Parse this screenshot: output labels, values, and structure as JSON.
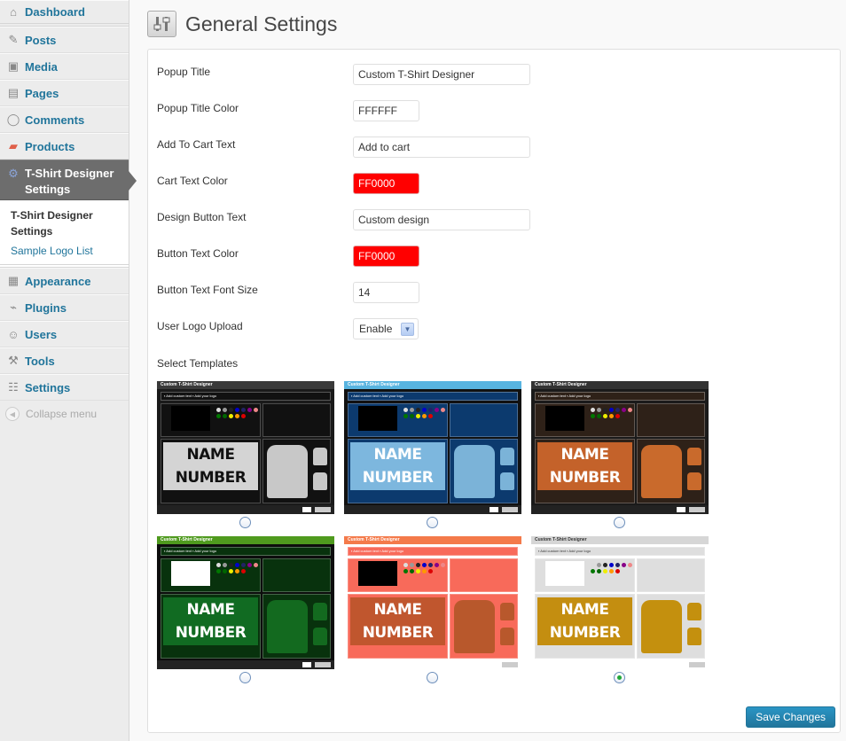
{
  "sidebar": {
    "items": [
      {
        "label": "Dashboard",
        "icon": "home-icon"
      },
      {
        "label": "Posts",
        "icon": "pushpin-icon"
      },
      {
        "label": "Media",
        "icon": "media-icon"
      },
      {
        "label": "Pages",
        "icon": "pages-icon"
      },
      {
        "label": "Comments",
        "icon": "comment-icon"
      },
      {
        "label": "Products",
        "icon": "products-icon"
      },
      {
        "label": "T-Shirt Designer Settings",
        "icon": "gear-icon"
      },
      {
        "label": "Appearance",
        "icon": "appearance-icon"
      },
      {
        "label": "Plugins",
        "icon": "plug-icon"
      },
      {
        "label": "Users",
        "icon": "users-icon"
      },
      {
        "label": "Tools",
        "icon": "tools-icon"
      },
      {
        "label": "Settings",
        "icon": "settings-icon"
      }
    ],
    "active_line1": "T-Shirt Designer",
    "active_line2": "Settings",
    "submenu": [
      {
        "label": "T-Shirt Designer Settings",
        "current": true
      },
      {
        "label": "Sample Logo List",
        "current": false
      }
    ],
    "collapse_label": "Collapse menu"
  },
  "header": {
    "title": "General Settings"
  },
  "form": {
    "popup_title": {
      "label": "Popup Title",
      "value": "Custom T-Shirt Designer"
    },
    "popup_title_color": {
      "label": "Popup Title Color",
      "value": "FFFFFF"
    },
    "add_to_cart_text": {
      "label": "Add To Cart Text",
      "value": "Add to cart"
    },
    "cart_text_color": {
      "label": "Cart Text Color",
      "value": "FF0000"
    },
    "design_button_text": {
      "label": "Design Button Text",
      "value": "Custom design"
    },
    "button_text_color": {
      "label": "Button Text Color",
      "value": "FF0000"
    },
    "button_text_font_size": {
      "label": "Button Text Font Size",
      "value": "14"
    },
    "user_logo_upload": {
      "label": "User Logo Upload",
      "value": "Enable"
    },
    "select_templates_label": "Select Templates"
  },
  "templates": [
    {
      "name": "Black",
      "title": "Custom T-Shirt Designer",
      "bar": "#3a3a3a",
      "bg": "#1a1a1a",
      "panel": "#111",
      "preview": "#d4d4d4",
      "preview_text": "#111",
      "shirt": "#c8c8c8",
      "selected": false
    },
    {
      "name": "Blue",
      "title": "Custom T-Shirt Designer",
      "bar": "#58b4e0",
      "bg": "#111",
      "panel": "#0c3a6e",
      "preview": "#7db7de",
      "preview_text": "#fff",
      "shirt": "#7bb3d8",
      "selected": false
    },
    {
      "name": "Brown",
      "title": "Custom T-Shirt Designer",
      "bar": "#333",
      "bg": "#1a1a1a",
      "panel": "#2e2118",
      "preview": "#c4622a",
      "preview_text": "#fff",
      "shirt": "#c96a2c",
      "selected": false
    },
    {
      "name": "Green",
      "title": "Custom T-Shirt Designer",
      "bar": "#4f9a1e",
      "bg": "#0d0d0d",
      "panel": "#08320d",
      "preview": "#116b22",
      "preview_text": "#fff",
      "shirt": "#136a1f",
      "selected": false
    },
    {
      "name": "Salmon",
      "title": "Custom T-Shirt Designer",
      "bar": "#f47a4a",
      "bg": "#fff",
      "panel": "#f86a5a",
      "preview": "#c0562e",
      "preview_text": "#fff",
      "shirt": "#b8582c",
      "selected": false
    },
    {
      "name": "Gold",
      "title": "Custom T-Shirt Designer",
      "bar": "#d6d6d6",
      "bg": "#fff",
      "panel": "#dedede",
      "preview": "#c48e10",
      "preview_text": "#fff",
      "shirt": "#c4900e",
      "selected": true
    }
  ],
  "template_texts": {
    "add_custom_text": "Add custom text",
    "add_your_logo": "Add your logo",
    "preview_line1": "NAME",
    "preview_line2": "NUMBER"
  },
  "actions": {
    "save_label": "Save Changes"
  }
}
